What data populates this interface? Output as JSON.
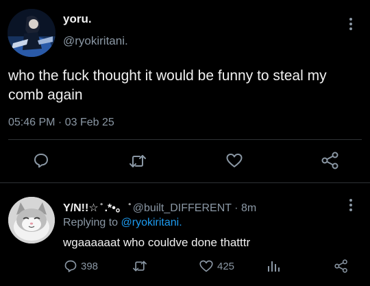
{
  "tweet": {
    "display_name": "yoru.",
    "handle": "@ryokiritani.",
    "text": "who the fuck thought it would be funny to steal my comb again",
    "timestamp": "05:46 PM · 03 Feb 25",
    "icons": {
      "avatar": "anime-character-avatar",
      "more": "more-options-icon",
      "reply": "reply-icon",
      "retweet": "retweet-icon",
      "like": "like-icon",
      "share": "share-icon"
    }
  },
  "reply": {
    "display_name": "Y/N!!☆ ̊ .*•。 ̊",
    "handle_and_time": "@built_DIFFERENT · 8m",
    "replying_prefix": "Replying to ",
    "replying_to": "@ryokiritani.",
    "text": "wgaaaaaat who couldve done thatttr",
    "reply_count": "398",
    "like_count": "425",
    "icons": {
      "avatar": "kitten-avatar",
      "more": "more-options-icon",
      "reply": "reply-icon",
      "retweet": "retweet-icon",
      "like": "like-icon",
      "views": "views-chart-icon",
      "share": "share-icon"
    }
  },
  "colors": {
    "background": "#000000",
    "primary_text": "#e7e9ea",
    "secondary_text": "#8b98a5",
    "link": "#1d9bf0",
    "divider": "#2f3336"
  }
}
